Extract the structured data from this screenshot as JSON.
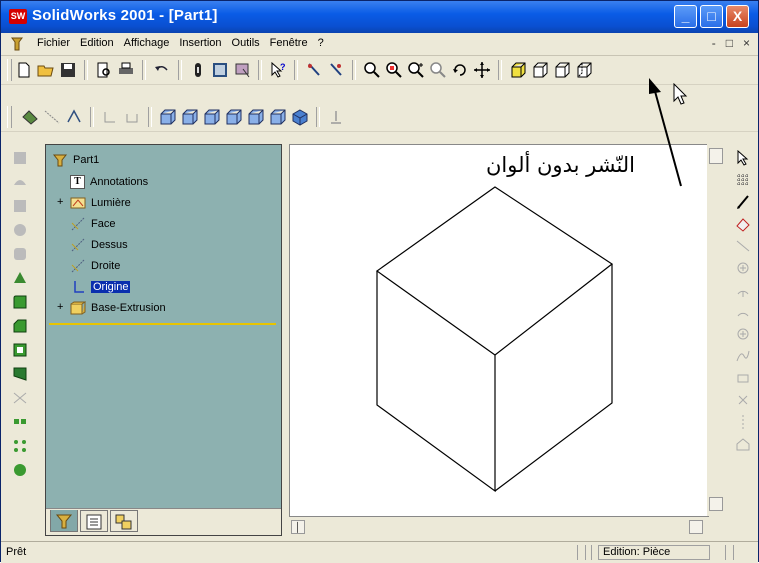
{
  "window": {
    "logo_text": "SW",
    "title": "SolidWorks 2001 - [Part1]",
    "controls": {
      "minimize": "_",
      "maximize": "□",
      "close": "X"
    }
  },
  "menu": {
    "items": [
      "Fichier",
      "Edition",
      "Affichage",
      "Insertion",
      "Outils",
      "Fenêtre",
      "?"
    ],
    "doc_controls": [
      "-",
      "□",
      "×"
    ]
  },
  "toolbar1": {
    "icons": [
      "new-document-icon",
      "open-folder-icon",
      "save-disk-icon",
      "print-preview-icon",
      "print-icon",
      "undo-icon",
      "rebuild-icon",
      "options-icon",
      "edit-appearance-icon",
      "whats-this-icon",
      "select-icon",
      "select-all-icon",
      "zoom-fit-icon",
      "zoom-window-icon",
      "zoom-in-out-icon",
      "zoom-selection-icon",
      "rotate-icon",
      "pan-icon",
      "wireframe-icon",
      "hidden-lines-icon",
      "hidden-removed-icon",
      "shaded-icon"
    ]
  },
  "toolbar2": {
    "icons": [
      "sketch-icon",
      "line-icon",
      "smart-dimension-icon",
      "relations-icon",
      "extrude-icon",
      "view-front-icon",
      "view-back-icon",
      "view-left-icon",
      "view-right-icon",
      "view-top-icon",
      "view-bottom-icon",
      "view-iso-icon",
      "normal-to-icon"
    ]
  },
  "annotation": {
    "text": "النّشر بدون ألوان"
  },
  "tree": {
    "root": "Part1",
    "items": [
      {
        "label": "Annotations",
        "icon": "annotations-icon",
        "expandable": false
      },
      {
        "label": "Lumière",
        "icon": "lighting-icon",
        "expandable": true
      },
      {
        "label": "Face",
        "icon": "plane-icon",
        "expandable": false
      },
      {
        "label": "Dessus",
        "icon": "plane-icon",
        "expandable": false
      },
      {
        "label": "Droite",
        "icon": "plane-icon",
        "expandable": false
      },
      {
        "label": "Origine",
        "icon": "origin-icon",
        "expandable": false,
        "selected": true
      },
      {
        "label": "Base-Extrusion",
        "icon": "extrusion-icon",
        "expandable": true
      }
    ]
  },
  "status": {
    "left": "Prêt",
    "mode": "Edition: Pièce"
  },
  "colors": {
    "title_bar": "#0a5ce6",
    "tree_background": "#8db1b0",
    "selection": "#0a2fae",
    "rollback_bar": "#e8c400"
  }
}
